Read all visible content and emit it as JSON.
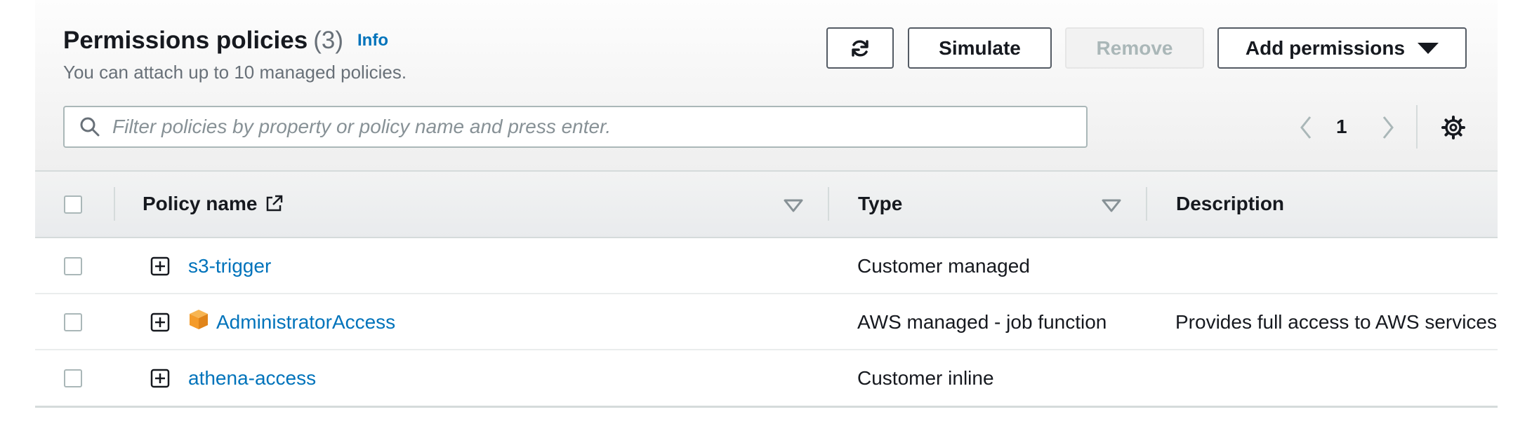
{
  "header": {
    "title": "Permissions policies",
    "count": "(3)",
    "info_link": "Info",
    "subtitle": "You can attach up to 10 managed policies."
  },
  "toolbar": {
    "refresh_icon": "refresh-icon",
    "simulate_label": "Simulate",
    "remove_label": "Remove",
    "add_permissions_label": "Add permissions"
  },
  "search": {
    "placeholder": "Filter policies by property or policy name and press enter."
  },
  "pagination": {
    "current_page": "1"
  },
  "table": {
    "columns": [
      "Policy name",
      "Type",
      "Description"
    ],
    "rows": [
      {
        "name": "s3-trigger",
        "type": "Customer managed",
        "description": "",
        "aws_managed": false
      },
      {
        "name": "AdministratorAccess",
        "type": "AWS managed - job function",
        "description": "Provides full access to AWS services",
        "aws_managed": true
      },
      {
        "name": "athena-access",
        "type": "Customer inline",
        "description": "",
        "aws_managed": false
      }
    ]
  },
  "colors": {
    "link": "#0073bb",
    "aws_icon": "#f49b2a",
    "border": "#545b64"
  }
}
